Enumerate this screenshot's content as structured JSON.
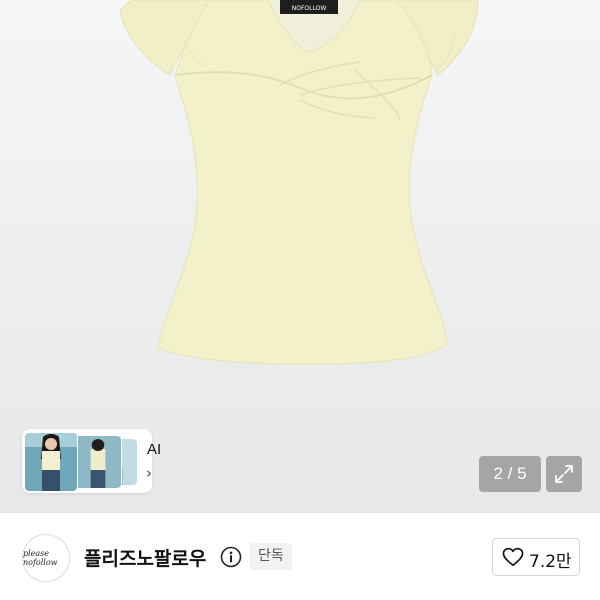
{
  "gallery": {
    "current_page": "2",
    "separator": "/",
    "total_pages": "5",
    "counter_text": "2 / 5",
    "product_tag_text": "NOFOLLOW",
    "background_color": "#eeeeef",
    "garment_color": "#f3f1c9"
  },
  "ai_card": {
    "label": "AI",
    "chevron": "›"
  },
  "brand": {
    "name": "플리즈노팔로우",
    "logo_text": "please nofollow",
    "badge": "단독"
  },
  "like": {
    "count": "7.2만"
  },
  "icons": {
    "expand": "expand-icon",
    "info": "info-icon",
    "heart": "heart-icon",
    "chevron": "chevron-right-icon"
  }
}
